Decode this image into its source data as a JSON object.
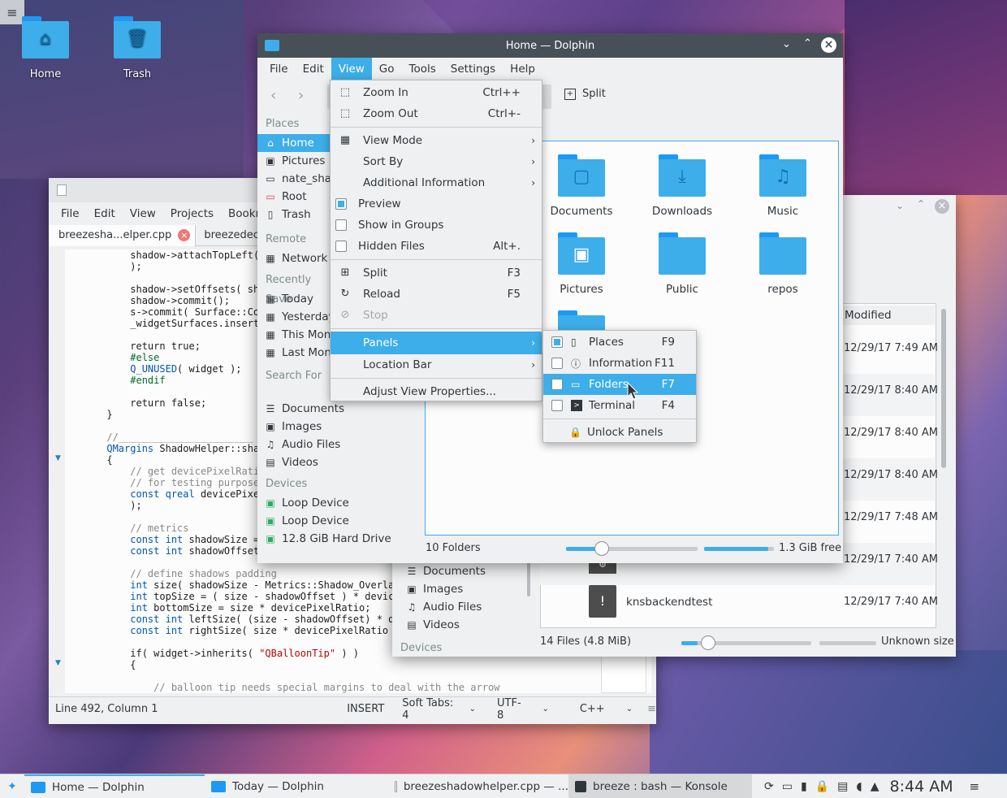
{
  "desktop": {
    "icons": [
      {
        "label": "Home",
        "glyph": "home-icon"
      },
      {
        "label": "Trash",
        "glyph": "trash-icon"
      }
    ]
  },
  "dolphin_main": {
    "title": "Home — Dolphin",
    "menu": [
      "File",
      "Edit",
      "View",
      "Go",
      "Tools",
      "Settings",
      "Help"
    ],
    "toolbar": {
      "split_label": "Split"
    },
    "places_heading": "Places",
    "places": [
      "Home",
      "Pictures",
      "nate_shar",
      "Root",
      "Trash"
    ],
    "remote_heading": "Remote",
    "remote": [
      "Network"
    ],
    "recent_heading": "Recently Save",
    "recent": [
      "Today",
      "Yesterday",
      "This Mont",
      "Last Mont"
    ],
    "search_heading": "Search For",
    "search": [
      "Documents",
      "Images",
      "Audio Files",
      "Videos"
    ],
    "devices_heading": "Devices",
    "devices": [
      "Loop Device",
      "Loop Device",
      "12.8 GiB Hard Drive"
    ],
    "folders": [
      "Documents",
      "Downloads",
      "Music",
      "Pictures",
      "Public",
      "repos"
    ],
    "status_left": "10 Folders",
    "status_right": "1.3 GiB free",
    "zoom_fraction": 0.27,
    "free_fraction": 0.92
  },
  "view_menu": {
    "items": [
      {
        "label": "Zoom In",
        "shortcut": "Ctrl++",
        "icon": "zoom-in-icon"
      },
      {
        "label": "Zoom Out",
        "shortcut": "Ctrl+-",
        "icon": "zoom-out-icon"
      },
      {
        "label": "View Mode",
        "icon": "view-mode-icon",
        "submenu": true
      },
      {
        "label": "Sort By",
        "icon": "sort-icon",
        "submenu": true
      },
      {
        "label": "Additional Information",
        "icon": "info-icon",
        "submenu": true
      },
      {
        "label": "Preview",
        "checked": true
      },
      {
        "label": "Show in Groups",
        "icon": "groups-icon"
      },
      {
        "label": "Hidden Files",
        "shortcut": "Alt+.",
        "checked": false
      },
      {
        "label": "Split",
        "shortcut": "F3",
        "icon": "split-icon"
      },
      {
        "label": "Reload",
        "shortcut": "F5",
        "icon": "reload-icon"
      },
      {
        "label": "Stop",
        "icon": "stop-icon",
        "disabled": true
      },
      {
        "label": "Panels",
        "submenu": true,
        "highlighted": true
      },
      {
        "label": "Location Bar",
        "submenu": true
      },
      {
        "label": "Adjust View Properties..."
      }
    ]
  },
  "panels_menu": {
    "items": [
      {
        "label": "Places",
        "shortcut": "F9",
        "checked": true
      },
      {
        "label": "Information",
        "shortcut": "F11",
        "checked": false
      },
      {
        "label": "Folders",
        "shortcut": "F7",
        "checked": false,
        "highlighted": true
      },
      {
        "label": "Terminal",
        "shortcut": "F4",
        "checked": false
      }
    ],
    "unlock": "Unlock Panels"
  },
  "kate": {
    "menu": [
      "File",
      "Edit",
      "View",
      "Projects",
      "Bookm"
    ],
    "tabs": [
      "breezesha...elper.cpp",
      "breezedecor"
    ],
    "status": {
      "position": "Line 492, Column 1",
      "mode": "INSERT",
      "tabs": "Soft Tabs: 4",
      "encoding": "UTF-8",
      "syntax": "C++"
    }
  },
  "dolphin_back": {
    "column_modified": "Modified",
    "dates": [
      "12/29/17 7:49 AM",
      "12/29/17 8:40 AM",
      "12/29/17 8:40 AM",
      "12/29/17 8:40 AM",
      "12/29/17 7:48 AM",
      "12/29/17 7:40 AM",
      "12/29/17 7:40 AM"
    ],
    "file_name": "knsbackendtest",
    "search": [
      "Documents",
      "Images",
      "Audio Files",
      "Videos"
    ],
    "devices_heading": "Devices",
    "status_left": "14 Files (4.8 MiB)",
    "status_right": "Unknown size"
  },
  "taskbar": {
    "tasks": [
      "Home — Dolphin",
      "Today — Dolphin",
      "breezeshadowhelper.cpp — ...",
      "breeze : bash — Konsole"
    ],
    "clock": "8:44 AM"
  }
}
